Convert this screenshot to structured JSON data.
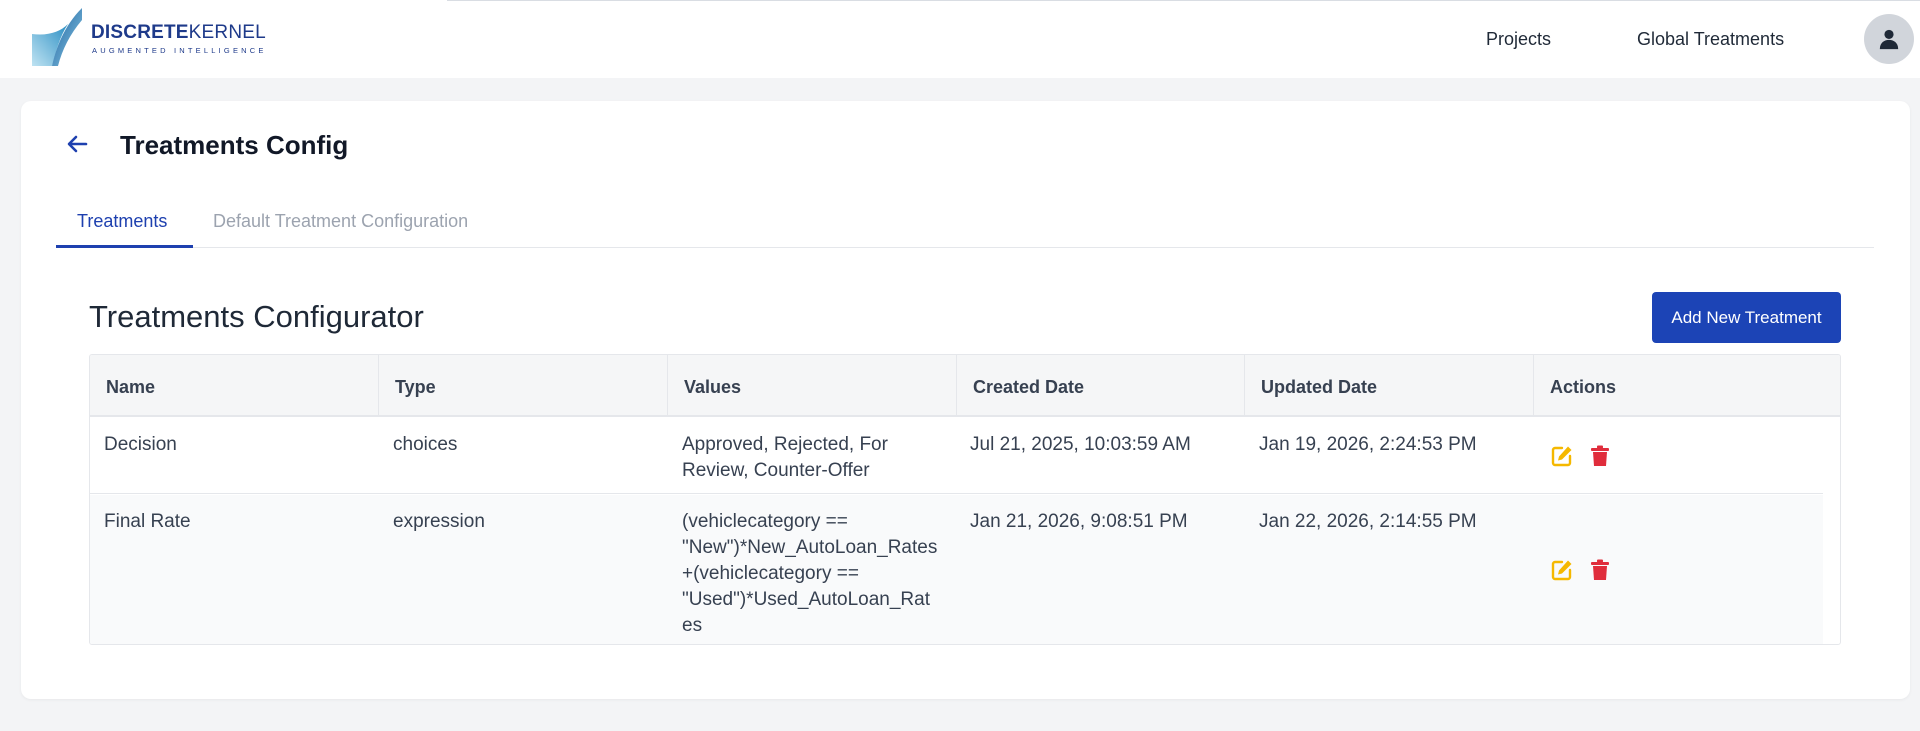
{
  "header": {
    "logo": {
      "brand_bold": "DISCRETE",
      "brand_light": "KERNEL",
      "tagline": "AUGMENTED INTELLIGENCE"
    },
    "nav": [
      {
        "label": "Projects"
      },
      {
        "label": "Global Treatments"
      }
    ],
    "avatar_icon": "user-icon"
  },
  "page": {
    "title": "Treatments Config",
    "back_icon": "arrow-left-icon",
    "tabs": [
      {
        "label": "Treatments",
        "active": true
      },
      {
        "label": "Default Treatment Configuration",
        "active": false
      }
    ]
  },
  "configurator": {
    "title": "Treatments Configurator",
    "add_button_label": "Add New Treatment",
    "columns": [
      "Name",
      "Type",
      "Values",
      "Created Date",
      "Updated Date",
      "Actions"
    ],
    "rows": [
      {
        "name": "Decision",
        "type": "choices",
        "values_lines": [
          "Approved, Rejected, For",
          "Review, Counter-Offer"
        ],
        "created": "Jul 21, 2025, 10:03:59 AM",
        "updated": "Jan 19, 2026, 2:24:53 PM"
      },
      {
        "name": "Final Rate",
        "type": "expression",
        "values_lines": [
          "(vehiclecategory ==",
          "\"New\")*New_AutoLoan_Rates",
          "+(vehiclecategory ==",
          "\"Used\")*Used_AutoLoan_Rat",
          "es"
        ],
        "created": "Jan 21, 2026, 9:08:51 PM",
        "updated": "Jan 22, 2026, 2:14:55 PM"
      }
    ]
  },
  "colors": {
    "primary": "#1c44b6",
    "tab_active": "#1e40af",
    "edit_icon": "#f5b800",
    "delete_icon": "#e02d3c"
  }
}
